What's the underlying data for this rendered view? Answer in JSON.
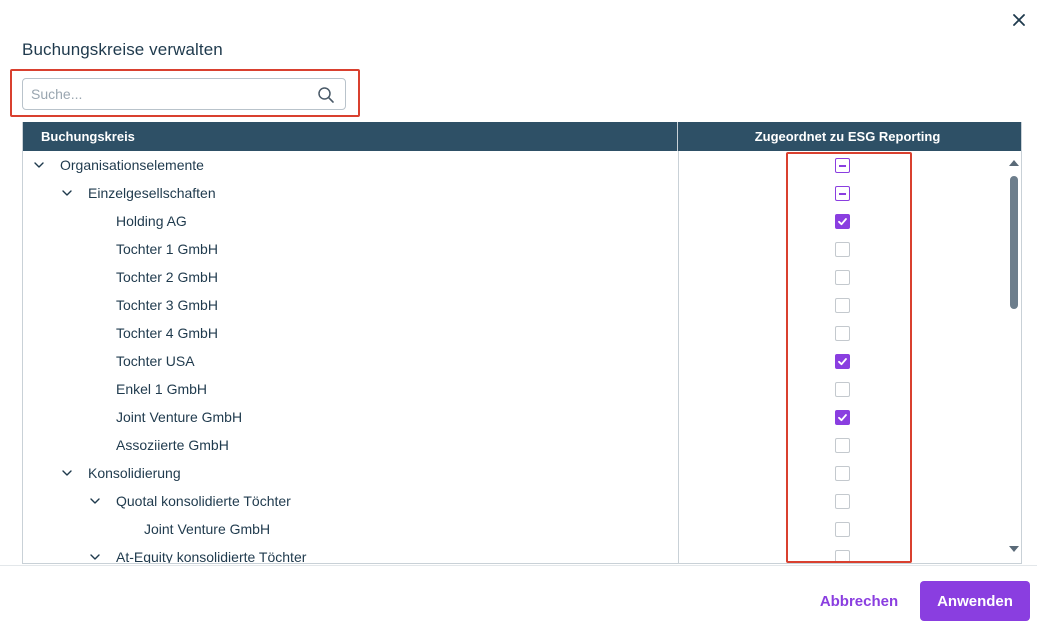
{
  "dialog": {
    "title": "Buchungskreise verwalten",
    "close_icon": "close-icon"
  },
  "search": {
    "placeholder": "Suche...",
    "value": "",
    "icon": "search-icon"
  },
  "table": {
    "columns": [
      "Buchungskreis",
      "Zugeordnet zu ESG Reporting"
    ],
    "rows": [
      {
        "label": "Organisationselemente",
        "level": 0,
        "expandable": true,
        "expanded": true,
        "state": "indeterminate"
      },
      {
        "label": "Einzelgesellschaften",
        "level": 1,
        "expandable": true,
        "expanded": true,
        "state": "indeterminate"
      },
      {
        "label": "Holding AG",
        "level": 2,
        "expandable": false,
        "state": "checked"
      },
      {
        "label": "Tochter 1 GmbH",
        "level": 2,
        "expandable": false,
        "state": "unchecked"
      },
      {
        "label": "Tochter 2 GmbH",
        "level": 2,
        "expandable": false,
        "state": "unchecked"
      },
      {
        "label": "Tochter 3 GmbH",
        "level": 2,
        "expandable": false,
        "state": "unchecked"
      },
      {
        "label": "Tochter 4 GmbH",
        "level": 2,
        "expandable": false,
        "state": "unchecked"
      },
      {
        "label": "Tochter USA",
        "level": 2,
        "expandable": false,
        "state": "checked"
      },
      {
        "label": "Enkel 1 GmbH",
        "level": 2,
        "expandable": false,
        "state": "unchecked"
      },
      {
        "label": "Joint Venture GmbH",
        "level": 2,
        "expandable": false,
        "state": "checked"
      },
      {
        "label": "Assoziierte GmbH",
        "level": 2,
        "expandable": false,
        "state": "unchecked"
      },
      {
        "label": "Konsolidierung",
        "level": 1,
        "expandable": true,
        "expanded": true,
        "state": "unchecked"
      },
      {
        "label": "Quotal konsolidierte Töchter",
        "level": 2,
        "expandable": true,
        "expanded": true,
        "state": "unchecked"
      },
      {
        "label": "Joint Venture GmbH",
        "level": 3,
        "expandable": false,
        "state": "unchecked"
      },
      {
        "label": "At-Equity konsolidierte Töchter",
        "level": 2,
        "expandable": true,
        "expanded": true,
        "state": "unchecked"
      }
    ]
  },
  "footer": {
    "cancel_label": "Abbrechen",
    "apply_label": "Anwenden"
  },
  "colors": {
    "accent": "#8a3ee0",
    "header_bg": "#2e5066",
    "highlight": "#d9402f",
    "text": "#1f3a4d"
  }
}
